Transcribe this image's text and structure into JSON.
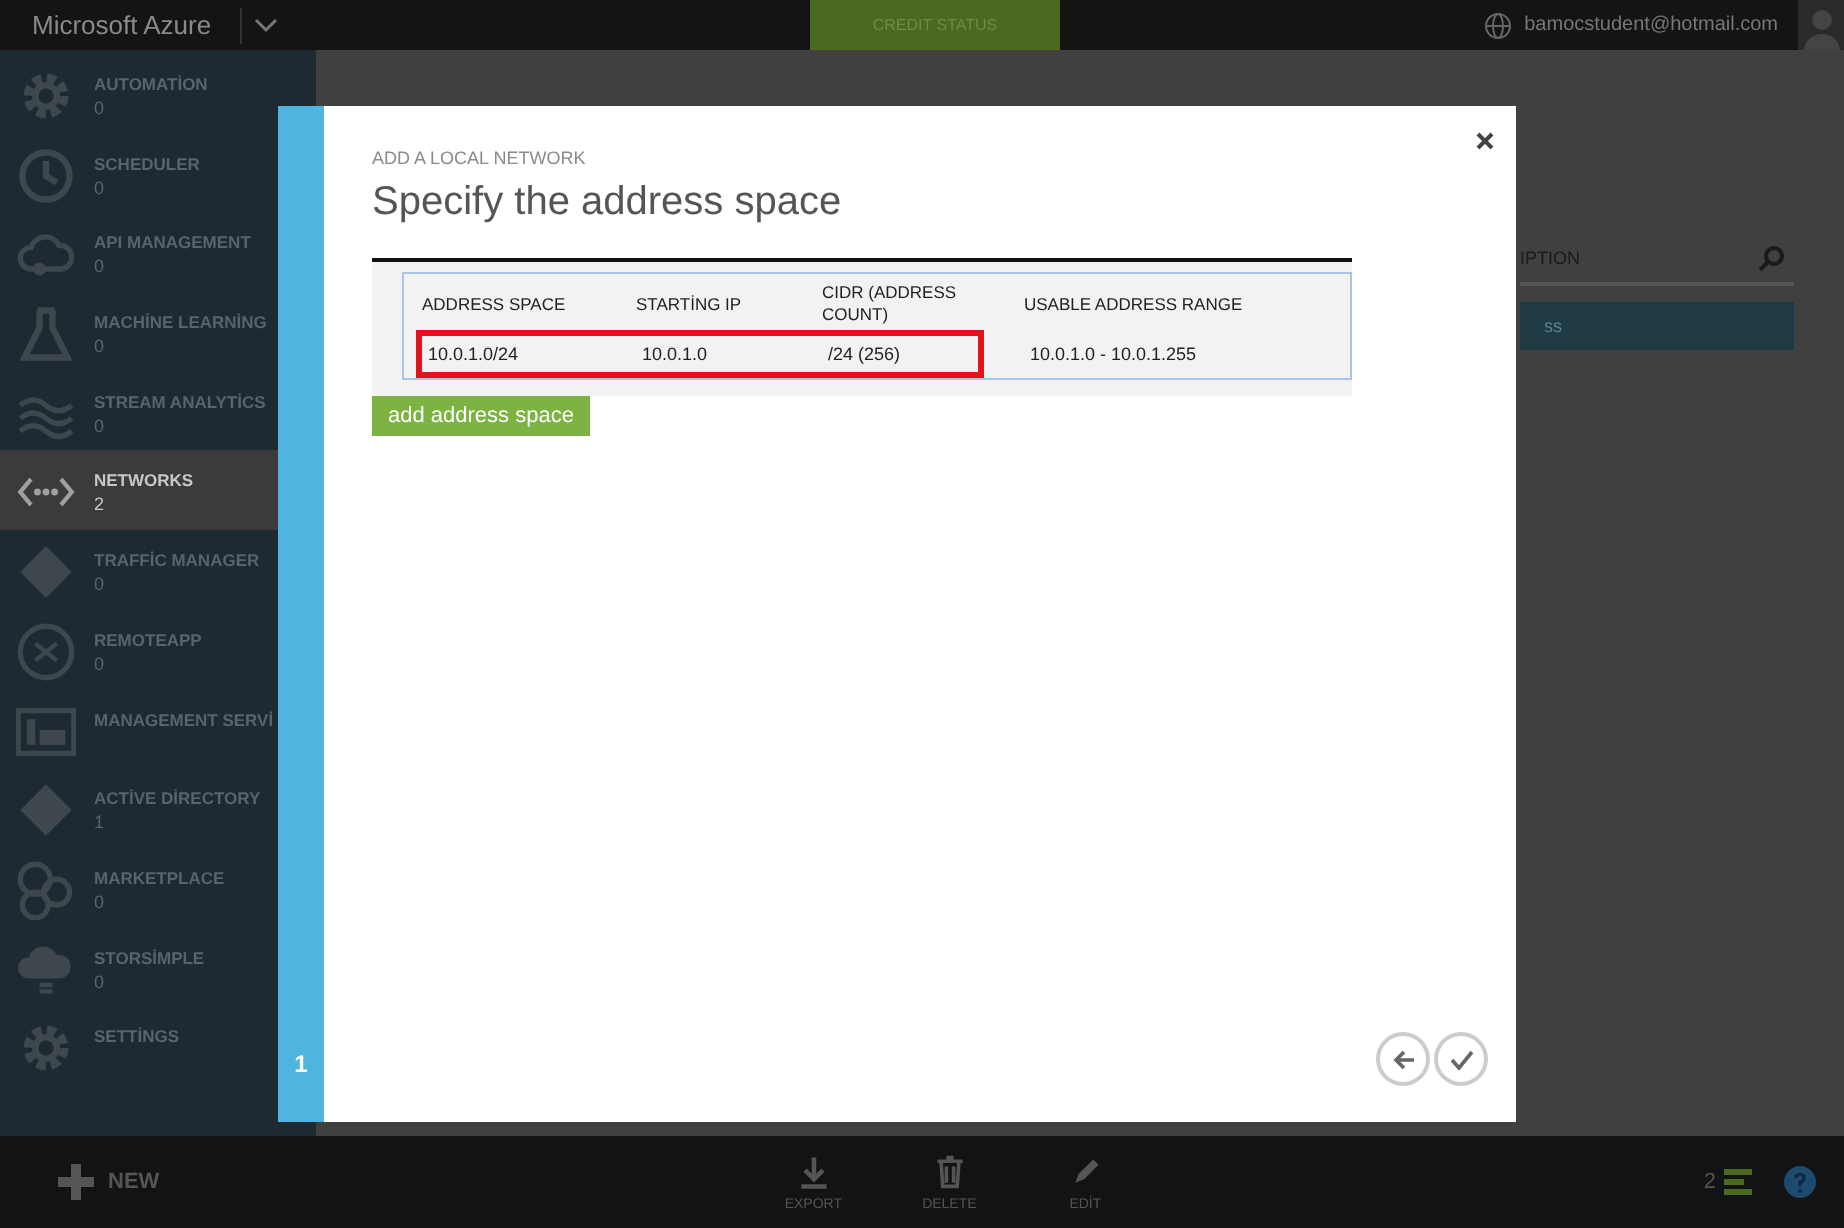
{
  "top_bar": {
    "brand": "Microsoft Azure",
    "credit_status": "CREDIT STATUS",
    "account": "bamocstudent@hotmail.com"
  },
  "sidebar": {
    "items": [
      {
        "label": "AUTOMATİON",
        "count": "0",
        "selected": false
      },
      {
        "label": "SCHEDULER",
        "count": "0",
        "selected": false
      },
      {
        "label": "API MANAGEMENT",
        "count": "0",
        "selected": false
      },
      {
        "label": "MACHİNE LEARNİNG",
        "count": "0",
        "selected": false
      },
      {
        "label": "STREAM ANALYTİCS",
        "count": "0",
        "selected": false
      },
      {
        "label": "NETWORKS",
        "count": "2",
        "selected": true
      },
      {
        "label": "TRAFFİC MANAGER",
        "count": "0",
        "selected": false
      },
      {
        "label": "REMOTEAPP",
        "count": "0",
        "selected": false
      },
      {
        "label": "MANAGEMENT SERVİ",
        "selected": false
      },
      {
        "label": "ACTİVE DİRECTORY",
        "count": "1",
        "selected": false
      },
      {
        "label": "MARKETPLACE",
        "count": "0",
        "selected": false
      },
      {
        "label": "STORSİMPLE",
        "count": "0",
        "selected": false
      },
      {
        "label": "SETTİNGS",
        "selected": false
      }
    ]
  },
  "background_list": {
    "column": "IPTION",
    "row": "ss"
  },
  "dialog": {
    "step": "1",
    "subtitle": "ADD A LOCAL NETWORK",
    "title": "Specify the address space",
    "table": {
      "columns": [
        "ADDRESS SPACE",
        "STARTİNG IP",
        "CIDR (ADDRESS COUNT)",
        "USABLE ADDRESS RANGE"
      ],
      "rows": [
        {
          "cells": [
            {
              "text": "10.0.1.0/24",
              "highlighted": true
            },
            {
              "text": "10.0.1.0",
              "highlighted": true
            },
            {
              "text": "/24 (256)",
              "highlighted": true
            },
            {
              "text": "10.0.1.0 - 10.0.1.255",
              "highlighted": false
            }
          ]
        }
      ]
    },
    "add_button": "add address space"
  },
  "command_bar": {
    "new": "NEW",
    "actions": [
      {
        "label": "EXPORT"
      },
      {
        "label": "DELETE"
      },
      {
        "label": "EDİT"
      }
    ],
    "notification_count": "2"
  }
}
